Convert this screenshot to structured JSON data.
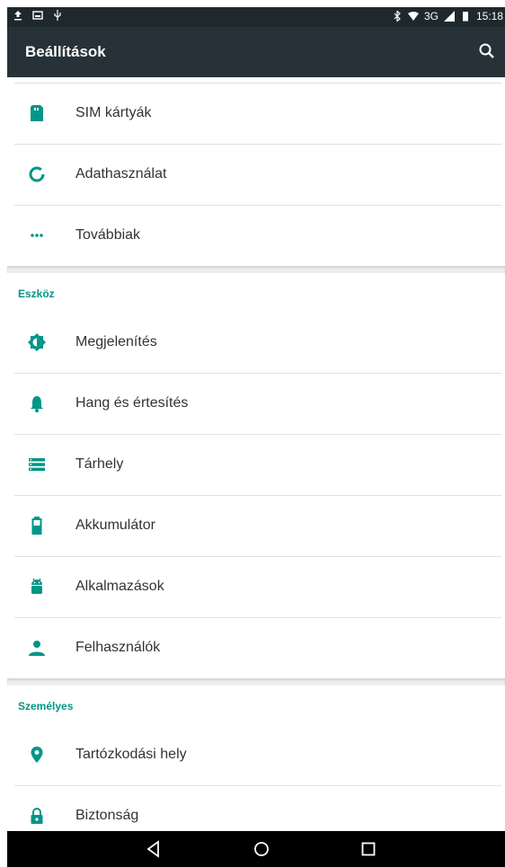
{
  "status_bar": {
    "left_icons": [
      "upload-icon",
      "image-icon",
      "usb-icon"
    ],
    "network": "3G",
    "time": "15:18"
  },
  "app_bar": {
    "title": "Beállítások",
    "search_icon": "search-icon"
  },
  "colors": {
    "accent": "#009688",
    "app_bar": "#263238",
    "status_bar": "#1f282d"
  },
  "list": {
    "items_top": [
      {
        "label": "SIM kártyák",
        "icon": "sim-card-icon"
      },
      {
        "label": "Adathasználat",
        "icon": "data-usage-icon"
      },
      {
        "label": "Továbbiak",
        "icon": "more-icon"
      }
    ],
    "section_device": {
      "title": "Eszköz",
      "items": [
        {
          "label": "Megjelenítés",
          "icon": "brightness-icon"
        },
        {
          "label": "Hang és értesítés",
          "icon": "bell-icon"
        },
        {
          "label": "Tárhely",
          "icon": "storage-icon"
        },
        {
          "label": "Akkumulátor",
          "icon": "battery-icon"
        },
        {
          "label": "Alkalmazások",
          "icon": "android-icon"
        },
        {
          "label": "Felhasználók",
          "icon": "person-icon"
        }
      ]
    },
    "section_personal": {
      "title": "Személyes",
      "items": [
        {
          "label": "Tartózkodási hely",
          "icon": "location-icon"
        },
        {
          "label": "Biztonság",
          "icon": "lock-icon"
        }
      ]
    }
  },
  "nav_bar": {
    "buttons": [
      "back-icon",
      "home-icon",
      "recents-icon"
    ]
  }
}
